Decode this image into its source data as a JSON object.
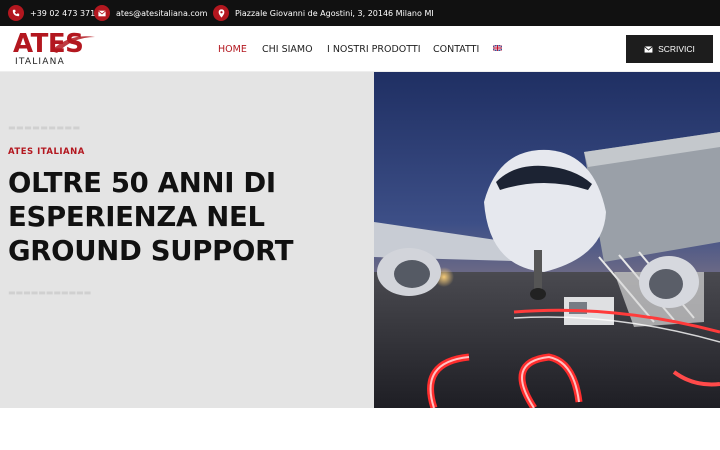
{
  "topbar": {
    "phone": {
      "icon": "phone-icon",
      "text": "+39 02 473 371"
    },
    "email": {
      "icon": "envelope-icon",
      "text": "ates@atesitaliana.com"
    },
    "address": {
      "icon": "map-pin-icon",
      "text": "Piazzale Giovanni de Agostini, 3, 20146 Milano MI"
    }
  },
  "header": {
    "logo": {
      "main": "ATES",
      "sub": "ITALIANA"
    },
    "nav": [
      {
        "label": "HOME",
        "active": true
      },
      {
        "label": "CHI SIAMO",
        "active": false
      },
      {
        "label": "I NOSTRI PRODOTTI",
        "active": false
      },
      {
        "label": "CONTATTI",
        "active": false
      }
    ],
    "language_flag": "uk-flag-icon",
    "cta": {
      "icon": "envelope-icon",
      "label": "SCRIVICI"
    }
  },
  "hero": {
    "label": "ATES ITALIANA",
    "title": "OLTRE 50 ANNI DI ESPERIENZA NEL GROUND SUPPORT",
    "image": "airplane-boarding-photo",
    "colors": {
      "accent": "#b3171f",
      "dark": "#111111",
      "panel": "#e4e4e4"
    }
  }
}
